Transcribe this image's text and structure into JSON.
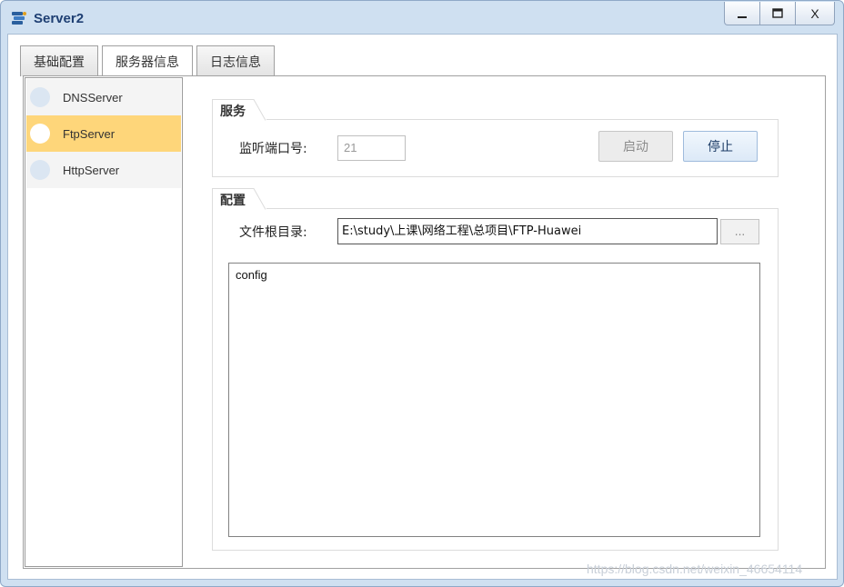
{
  "window": {
    "title": "Server2",
    "controls": {
      "minimize": "—",
      "maximize": "☐",
      "close": "X"
    }
  },
  "tabs": [
    {
      "label": "基础配置",
      "active": false
    },
    {
      "label": "服务器信息",
      "active": true
    },
    {
      "label": "日志信息",
      "active": false
    }
  ],
  "servers": [
    {
      "label": "DNSServer",
      "selected": false
    },
    {
      "label": "FtpServer",
      "selected": true
    },
    {
      "label": "HttpServer",
      "selected": false
    }
  ],
  "service": {
    "group_title": "服务",
    "port_label": "监听端口号:",
    "port_value": "21",
    "start_label": "启动",
    "stop_label": "停止"
  },
  "config": {
    "group_title": "配置",
    "root_label": "文件根目录:",
    "root_value": "E:\\study\\上课\\网络工程\\总项目\\FTP-Huawei",
    "browse_label": "...",
    "files": [
      "config"
    ]
  },
  "watermark": "https://blog.csdn.net/weixin_46654114",
  "colors": {
    "selected": "#fed67a",
    "title": "#1e3f73",
    "frame": "#cfe0f1"
  }
}
